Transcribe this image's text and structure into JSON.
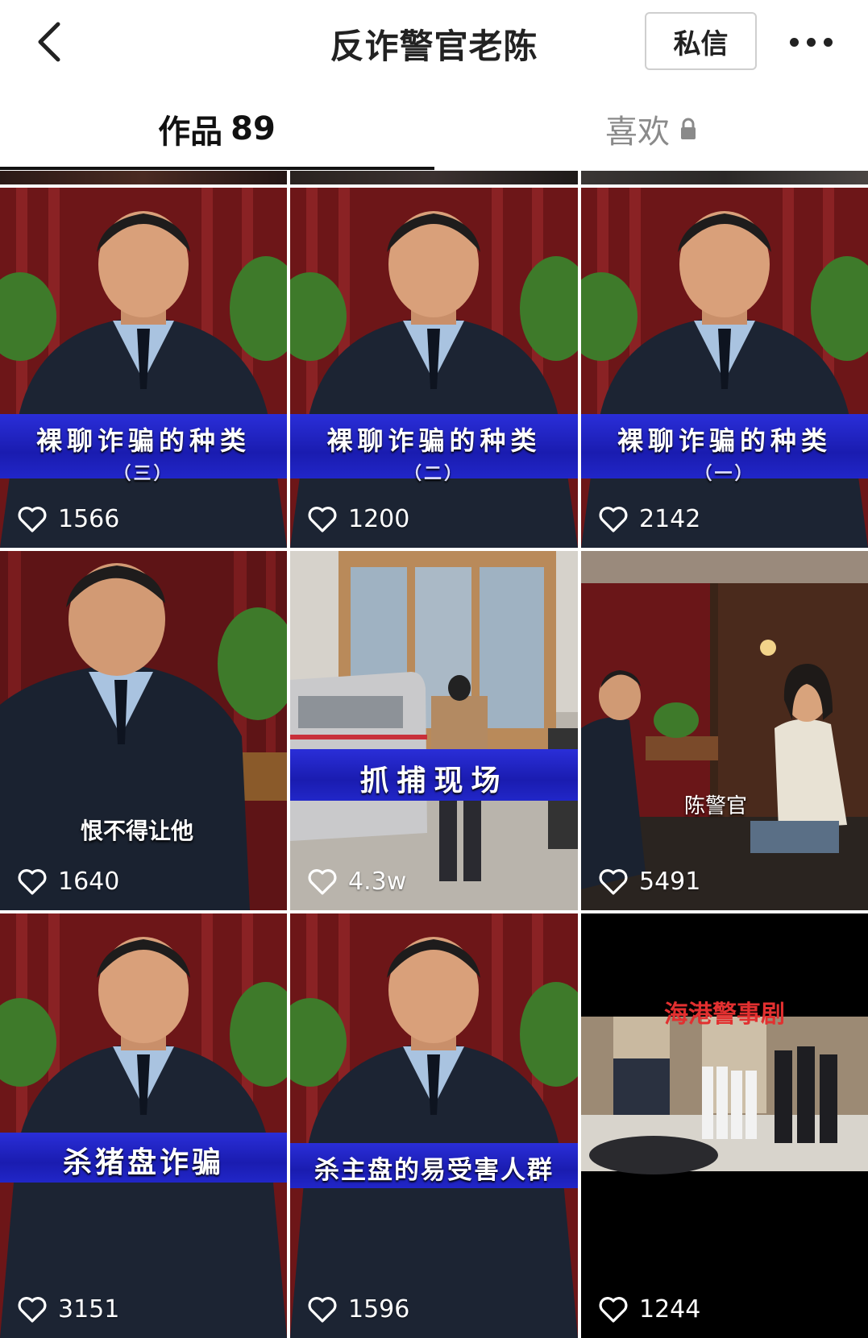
{
  "header": {
    "title": "反诈警官老陈",
    "message_button": "私信"
  },
  "tabs": {
    "works_label": "作品",
    "works_count": "89",
    "likes_label": "喜欢"
  },
  "videos": [
    {
      "banner_main": "裸聊诈骗的种类",
      "banner_sub": "（三）",
      "likes": "1566"
    },
    {
      "banner_main": "裸聊诈骗的种类",
      "banner_sub": "（二）",
      "likes": "1200"
    },
    {
      "banner_main": "裸聊诈骗的种类",
      "banner_sub": "（一）",
      "likes": "2142"
    },
    {
      "caption": "恨不得让他",
      "likes": "1640"
    },
    {
      "banner_main": "抓捕现场",
      "likes": "4.3w"
    },
    {
      "caption": "陈警官",
      "likes": "5491"
    },
    {
      "banner_main": "杀猪盘诈骗",
      "likes": "3151"
    },
    {
      "banner_main": "杀主盘的易受害人群",
      "likes": "1596"
    },
    {
      "caption_red": "海港警事剧",
      "likes": "1244"
    }
  ],
  "colors": {
    "banner_blue": "#2126c8",
    "curtain_red": "#7a1a1c",
    "uniform_navy": "#1c2433",
    "tab_inactive": "#8a8a8a"
  }
}
